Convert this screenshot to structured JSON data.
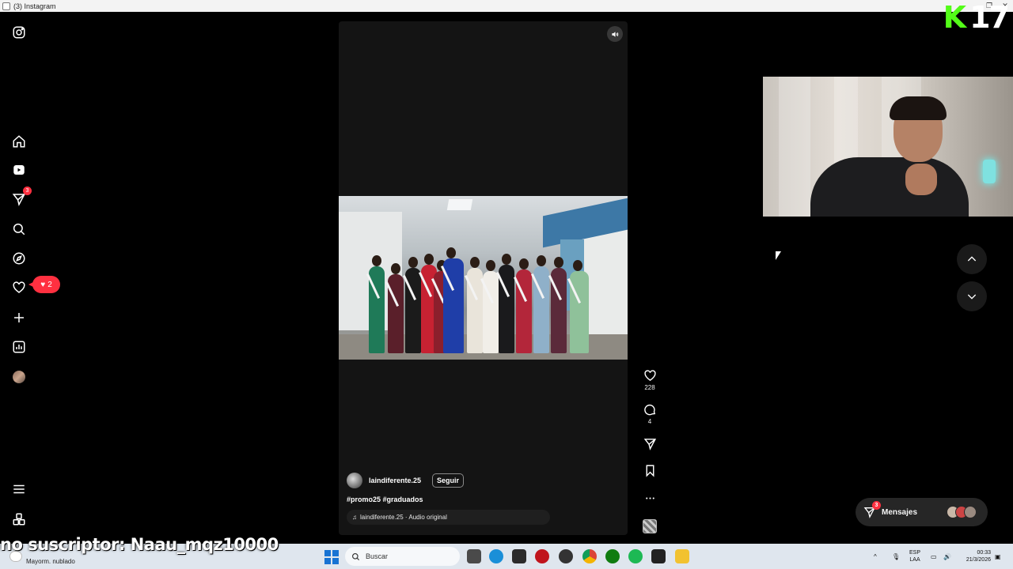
{
  "window": {
    "title": "(3) Instagram"
  },
  "sidebar": {
    "direct_badge": "3",
    "notifications_count": "2"
  },
  "reel": {
    "author": "laindiferente.25",
    "follow_label": "Seguir",
    "caption": "#promo25 #graduados",
    "audio": "laindiferente.25 · Audio original",
    "likes": "228",
    "comments": "4"
  },
  "messages": {
    "label": "Mensajes",
    "badge": "3"
  },
  "stream": {
    "brand_number": "17",
    "ticker": "no suscriptor: Naau_mqz10000"
  },
  "taskbar": {
    "weather": "Mayorm. nublado",
    "search_placeholder": "Buscar",
    "lang_line1": "ESP",
    "lang_line2": "LAA",
    "time": "00:33",
    "date": "21/3/2026"
  },
  "colors": {
    "accent_red": "#ff3040",
    "kick_green": "#53fc18",
    "windows_blue": "#1873d3"
  }
}
